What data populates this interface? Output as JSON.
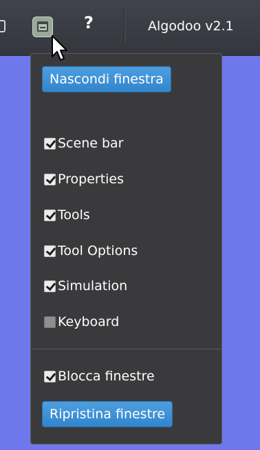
{
  "toolbar": {
    "help_label": "?",
    "app_title": "Algodoo v2.1",
    "window_button_icon": "window-icon"
  },
  "menu": {
    "hide_window_label": "Nascondi finestra",
    "items": [
      {
        "label": "Scene bar",
        "checked": true
      },
      {
        "label": "Properties",
        "checked": true
      },
      {
        "label": "Tools",
        "checked": true
      },
      {
        "label": "Tool Options",
        "checked": true
      },
      {
        "label": "Simulation",
        "checked": true
      },
      {
        "label": "Keyboard",
        "checked": false
      }
    ],
    "lock_windows": {
      "label": "Blocca finestre",
      "checked": true
    },
    "restore_windows_label": "Ripristina finestre"
  },
  "colors": {
    "background": "#6f78ea",
    "toolbar": "#3a3d44",
    "panel": "#3a3a3c",
    "button_accent": "#3d8fd6",
    "active_toolbar_button": "#9aa79a"
  }
}
